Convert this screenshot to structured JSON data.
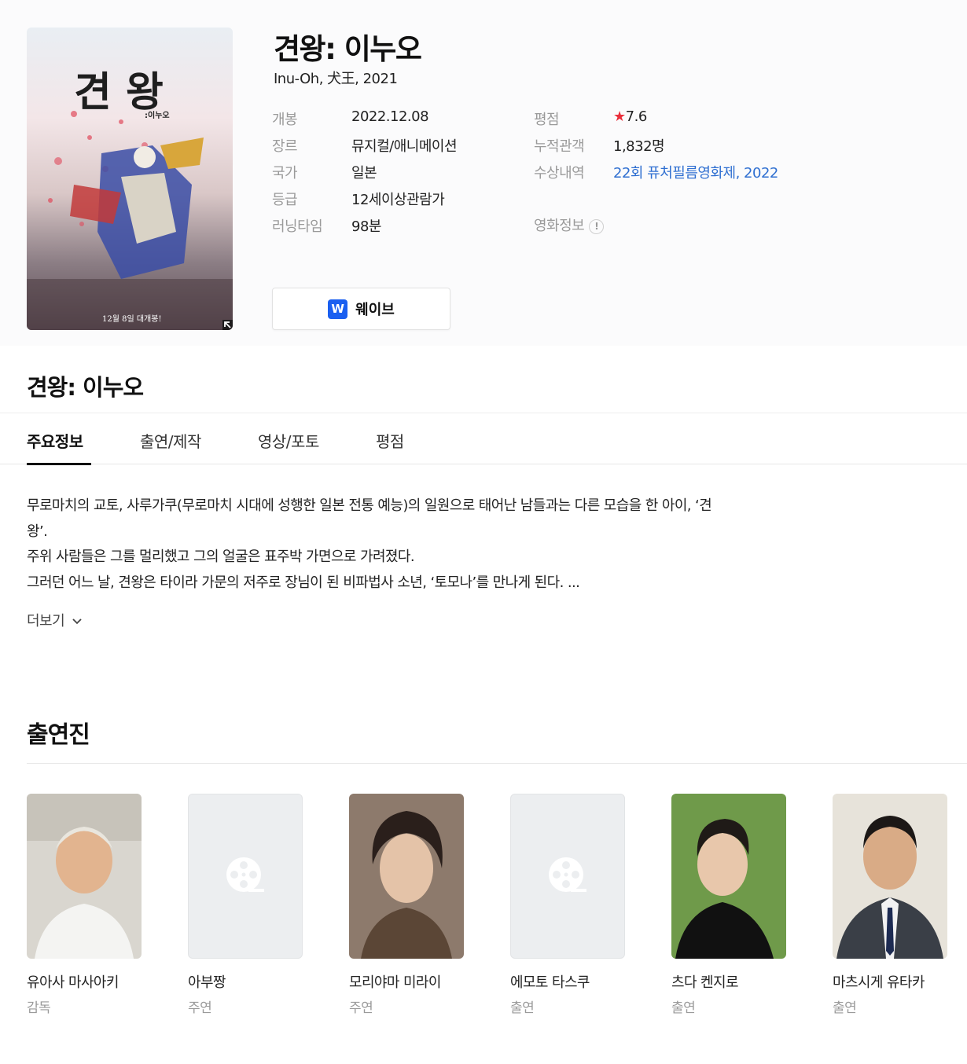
{
  "movie": {
    "title": "견왕: 이누오",
    "subtitle": "Inu-Oh, 犬王, 2021",
    "poster": {
      "title_text": "견 왕",
      "subtitle_text": ":이누오",
      "release_text": "12월 8일 대개봉!"
    },
    "info_left": [
      {
        "label": "개봉",
        "value": "2022.12.08"
      },
      {
        "label": "장르",
        "value": "뮤지컬/애니메이션"
      },
      {
        "label": "국가",
        "value": "일본"
      },
      {
        "label": "등급",
        "value": "12세이상관람가"
      },
      {
        "label": "러닝타임",
        "value": "98분"
      }
    ],
    "info_right": {
      "rating_label": "평점",
      "rating_star": "★",
      "rating_value": "7.6",
      "audience_label": "누적관객",
      "audience_value": "1,832명",
      "awards_label": "수상내역",
      "awards_value": "22회 퓨처필름영화제, 2022",
      "movie_info_label": "영화정보",
      "movie_info_icon": "!"
    },
    "stream": {
      "logo": "W",
      "label": "웨이브"
    }
  },
  "section_title": "견왕: 이누오",
  "tabs": [
    {
      "label": "주요정보"
    },
    {
      "label": "출연/제작"
    },
    {
      "label": "영상/포토"
    },
    {
      "label": "평점"
    }
  ],
  "synopsis": {
    "lines": [
      "무로마치의 교토, 사루가쿠(무로마치 시대에 성행한 일본 전통 예능)의 일원으로 태어난 남들과는 다른 모습을 한 아이, ‘견",
      "왕’.",
      "주위 사람들은 그를 멀리했고 그의 얼굴은 표주박 가면으로 가려졌다.",
      "그러던 어느 날, 견왕은 타이라 가문의 저주로 장님이 된 비파법사 소년, ‘토모나’를 만나게 된다. ..."
    ],
    "more_label": "더보기"
  },
  "cast": {
    "title": "출연진",
    "people": [
      {
        "name": "유아사 마사아키",
        "role": "감독"
      },
      {
        "name": "아부짱",
        "role": "주연"
      },
      {
        "name": "모리야마 미라이",
        "role": "주연"
      },
      {
        "name": "에모토 타스쿠",
        "role": "출연"
      },
      {
        "name": "츠다 켄지로",
        "role": "출연"
      },
      {
        "name": "마츠시게 유타카",
        "role": "출연"
      }
    ]
  },
  "colors": {
    "link": "#2f6fd1",
    "star": "#ea2e3b",
    "wavve": "#1a5ff0",
    "label_gray": "#9a9a9a"
  }
}
